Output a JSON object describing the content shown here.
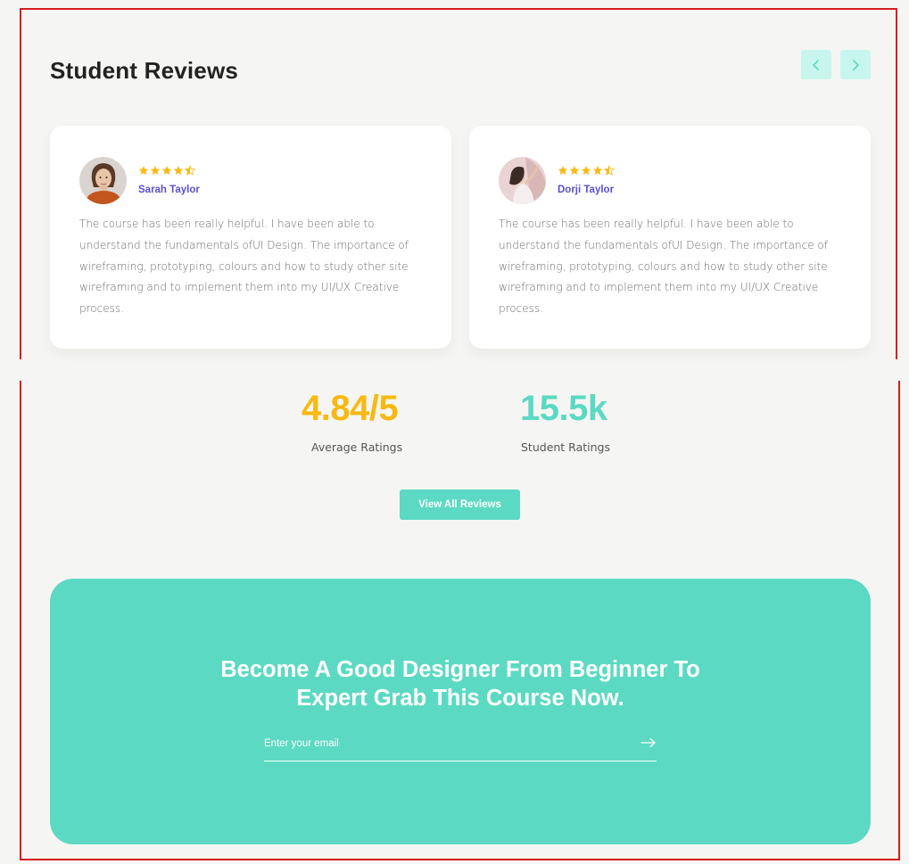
{
  "reviews_section": {
    "title": "Student Reviews",
    "prev_icon": "chevron-left-icon",
    "next_icon": "chevron-right-icon",
    "accent_color": "#5cd9c2",
    "reviews": [
      {
        "name": "Sarah Taylor",
        "rating": 4.5,
        "avatar": "avatar-photo",
        "text": "The course has been really helpful. I have been able to understand the fundamentals ofUI Design. The importance of wireframing, prototyping, colours and how to study other site wireframing and to implement them into my UI/UX Creative process."
      },
      {
        "name": "Dorji Taylor",
        "rating": 4.5,
        "avatar": "avatar-photo",
        "text": "The course has been really helpful. I have been able to understand the fundamentals ofUI Design. The importance of wireframing, prototyping, colours and how to study other site wireframing and to implement them into my UI/UX Creative process."
      }
    ]
  },
  "stats": {
    "average": {
      "value": "4.84/5",
      "label": "Average Ratings",
      "color": "#f8b912"
    },
    "students": {
      "value": "15.5k",
      "label": "Student Ratings",
      "color": "#5cd9c2"
    }
  },
  "view_all_label": "View All Reviews",
  "cta": {
    "heading_line1": "Become A Good Designer From Beginner To",
    "heading_line2": "Expert Grab This Course Now.",
    "email_placeholder": "Enter your email",
    "submit_icon": "arrow-right-icon"
  }
}
